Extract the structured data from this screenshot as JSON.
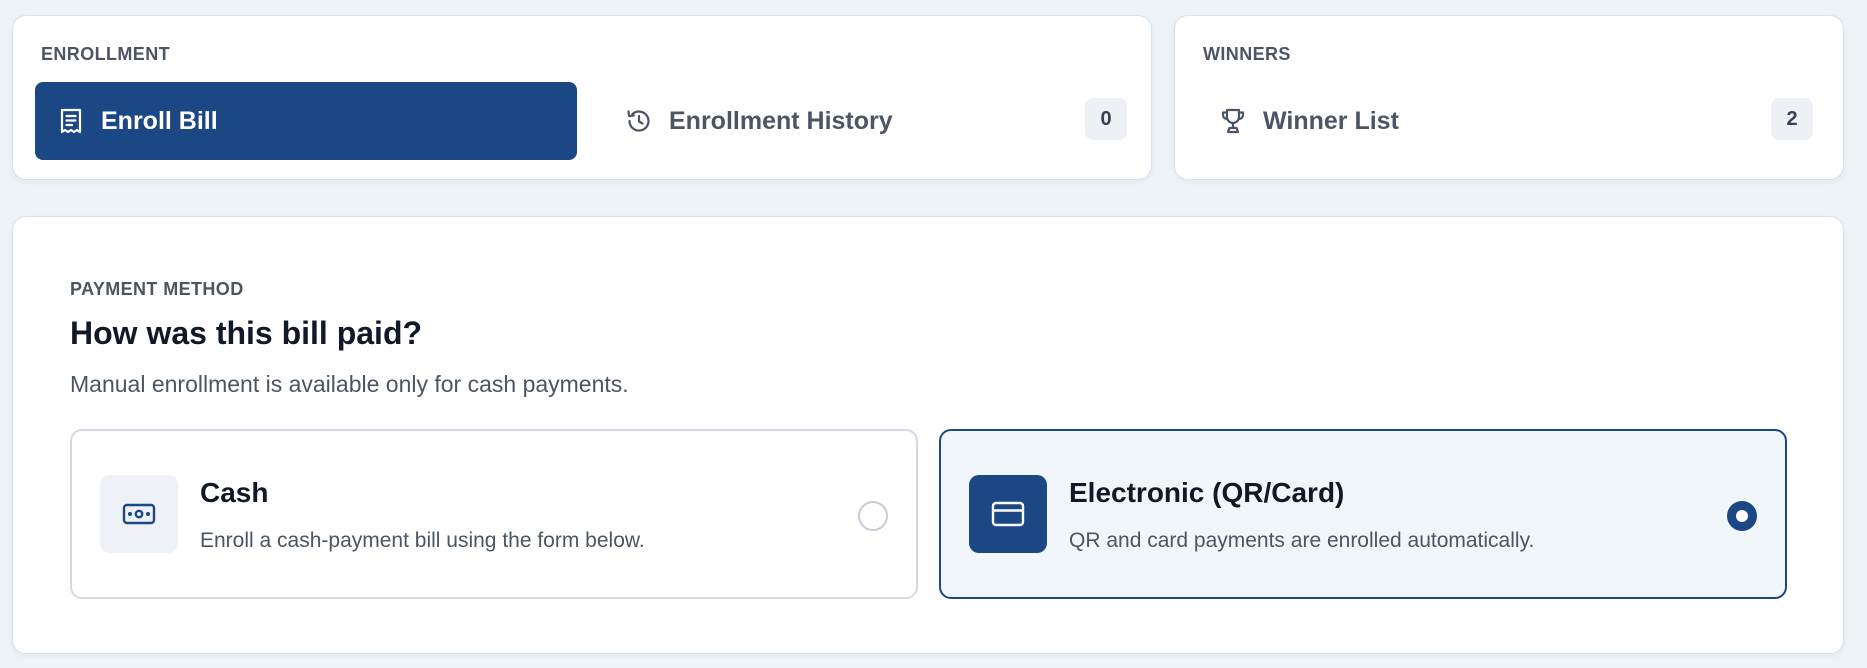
{
  "enrollment": {
    "section_label": "ENROLLMENT",
    "enroll_bill": {
      "label": "Enroll Bill",
      "icon": "receipt-icon",
      "active": true
    },
    "enrollment_history": {
      "label": "Enrollment History",
      "icon": "history-icon",
      "count": "0"
    }
  },
  "winners": {
    "section_label": "WINNERS",
    "winner_list": {
      "label": "Winner List",
      "icon": "trophy-icon",
      "count": "2"
    }
  },
  "payment": {
    "section_label": "PAYMENT METHOD",
    "heading": "How was this bill paid?",
    "subtitle": "Manual enrollment is available only for cash payments.",
    "options": [
      {
        "title": "Cash",
        "description": "Enroll a cash-payment bill using the form below.",
        "icon": "cash-icon",
        "selected": false
      },
      {
        "title": "Electronic (QR/Card)",
        "description": "QR and card payments are enrolled automatically.",
        "icon": "card-icon",
        "selected": true
      }
    ]
  },
  "colors": {
    "primary": "#1b4884",
    "background": "#eef3f8",
    "selected_option_bg": "#f1f6fa"
  }
}
